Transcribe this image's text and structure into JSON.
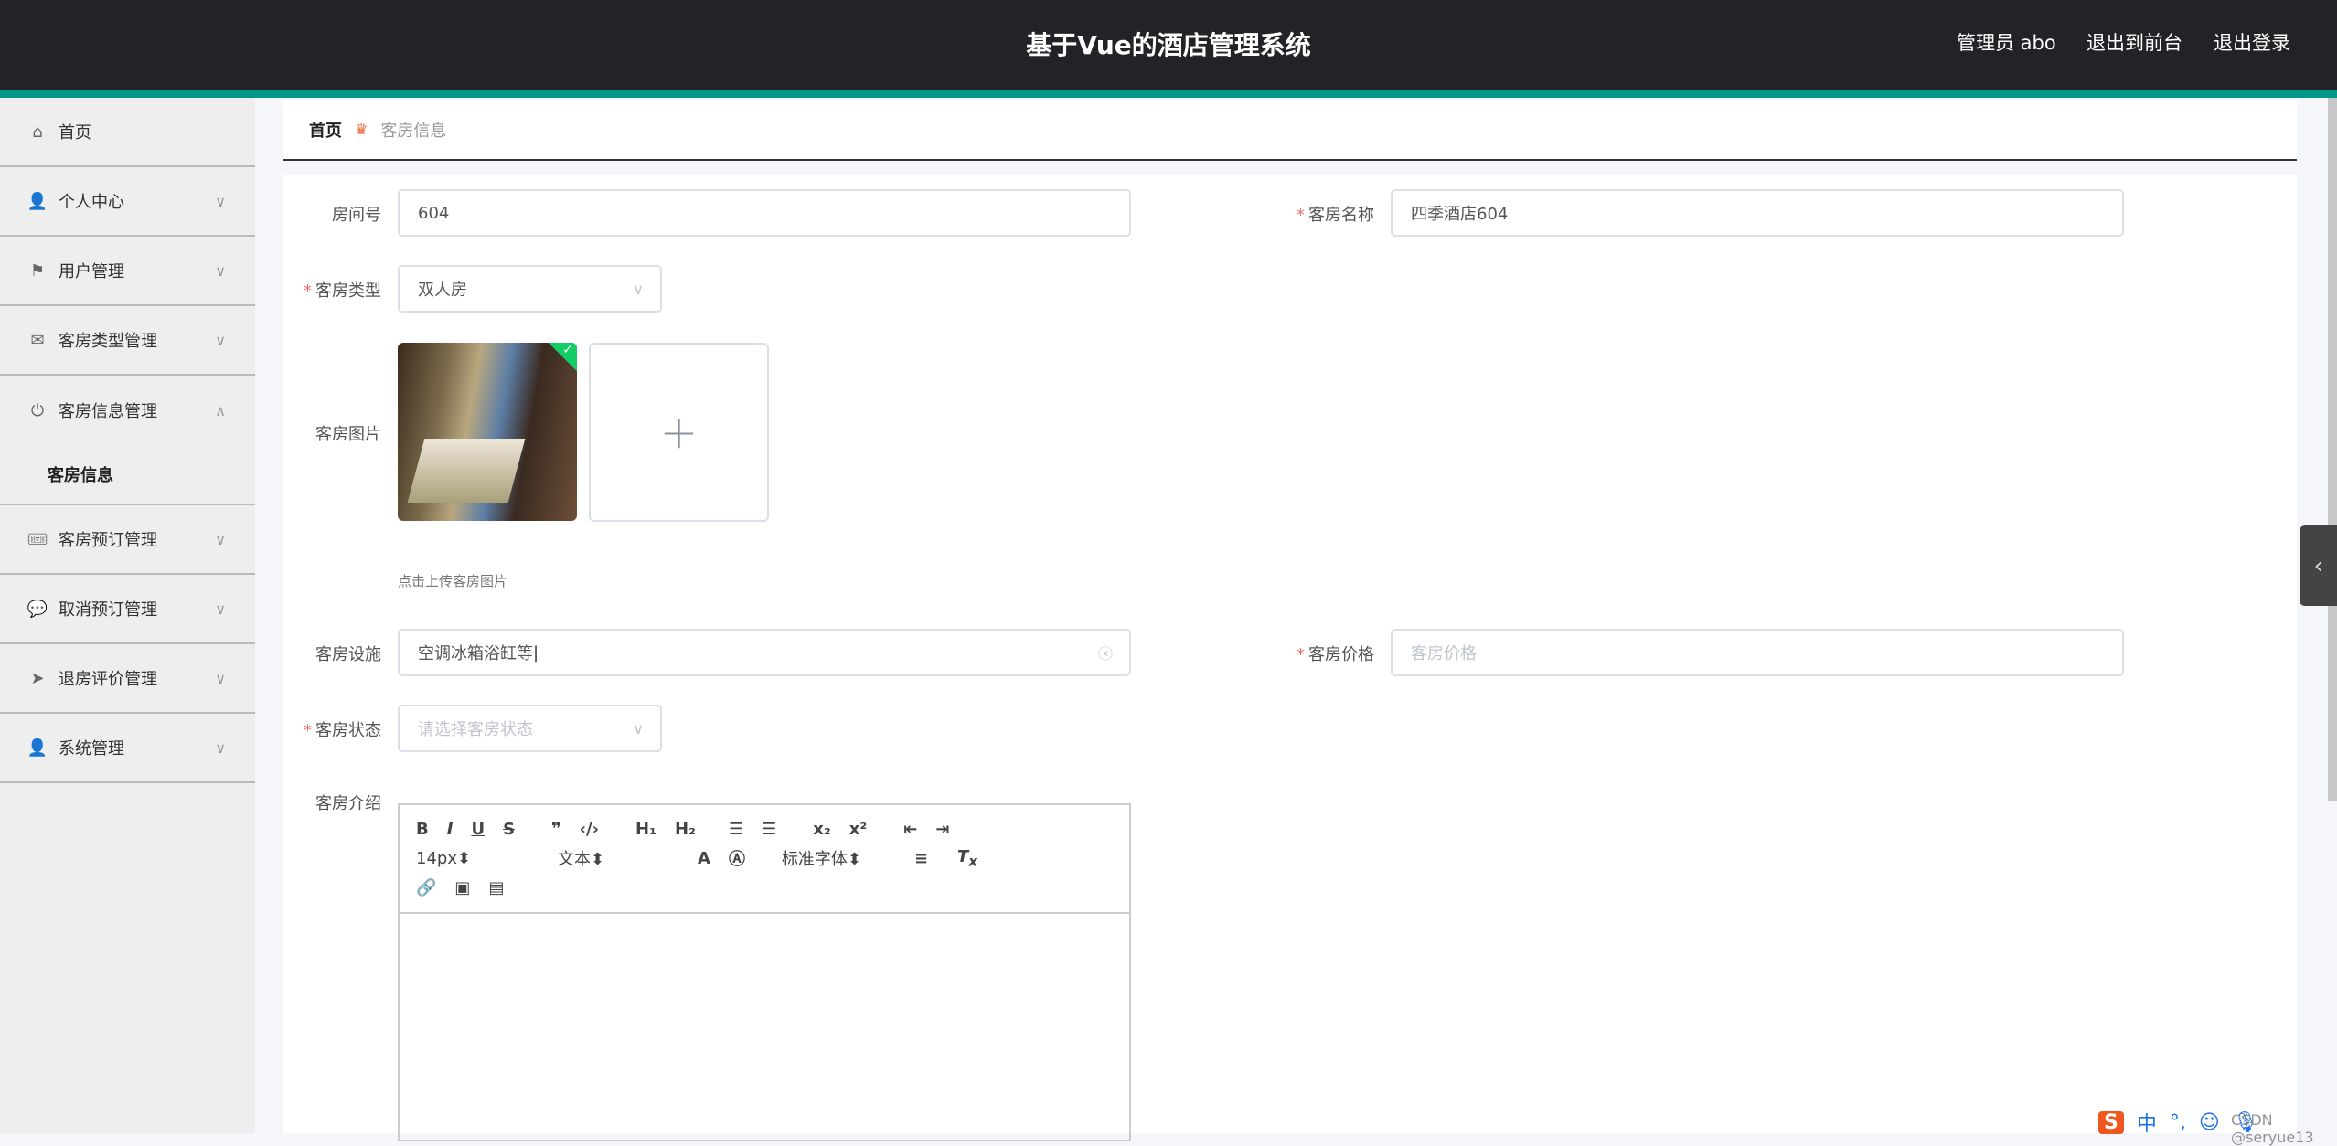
{
  "header": {
    "title": "基于Vue的酒店管理系统",
    "user": "管理员 abo",
    "front": "退出到前台",
    "logout": "退出登录"
  },
  "sidebar": {
    "items": [
      {
        "label": "首页",
        "icon": "⌂"
      },
      {
        "label": "个人中心",
        "icon": "👤"
      },
      {
        "label": "用户管理",
        "icon": "⚑"
      },
      {
        "label": "客房类型管理",
        "icon": "✉"
      },
      {
        "label": "客房信息管理",
        "icon": "⏻"
      },
      {
        "label": "客房预订管理",
        "icon": "🎟"
      },
      {
        "label": "取消预订管理",
        "icon": "💬"
      },
      {
        "label": "退房评价管理",
        "icon": "➤"
      },
      {
        "label": "系统管理",
        "icon": "👤"
      }
    ],
    "sub": "客房信息"
  },
  "breadcrumb": {
    "home": "首页",
    "current": "客房信息"
  },
  "form": {
    "room_no_label": "房间号",
    "room_no": "604",
    "room_name_label": "客房名称",
    "room_name": "四季酒店604",
    "type_label": "客房类型",
    "type": "双人房",
    "image_label": "客房图片",
    "upload_tip": "点击上传客房图片",
    "facility_label": "客房设施",
    "facility": "空调冰箱浴缸等",
    "price_label": "客房价格",
    "price_placeholder": "客房价格",
    "status_label": "客房状态",
    "status_placeholder": "请选择客房状态",
    "intro_label": "客房介绍"
  },
  "editor": {
    "size": "14px",
    "header": "文本",
    "font": "标准字体"
  },
  "watermark": "CSDN @seryue13",
  "ime": {
    "lang": "中"
  }
}
